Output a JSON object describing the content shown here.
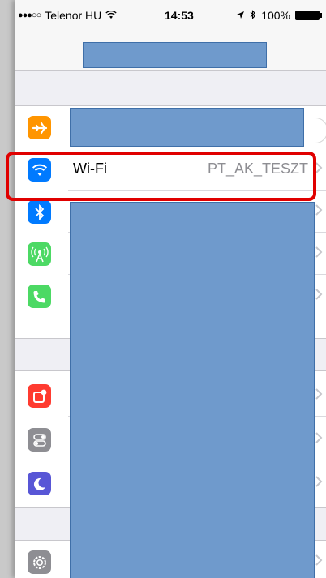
{
  "status_bar": {
    "signal_dots": "●●●○○",
    "carrier": "Telenor HU",
    "time": "14:53",
    "battery": "100%",
    "icons": [
      "wifi-icon",
      "location-arrow-icon",
      "bluetooth-icon",
      "battery-icon"
    ]
  },
  "settings": {
    "wifi": {
      "label": "Wi-Fi",
      "value": "PT_AK_TESZT"
    },
    "group1_icons": [
      "airplane-mode-icon",
      "wifi-icon",
      "bluetooth-icon",
      "cellular-icon",
      "phone-icon"
    ],
    "group2_icons": [
      "notifications-icon",
      "control-center-icon",
      "do-not-disturb-icon"
    ],
    "group3_icons": [
      "gear-icon"
    ]
  },
  "colors": {
    "airplane": "#ff9500",
    "wifi": "#007aff",
    "bluetooth": "#007aff",
    "cellular": "#4cd964",
    "phone": "#4cd964",
    "notifications": "#ff3b30",
    "control_center": "#8e8e93",
    "do_not_disturb": "#5856d6",
    "general": "#8e8e93",
    "highlight": "#e00000",
    "redaction": "#6f9acc"
  }
}
